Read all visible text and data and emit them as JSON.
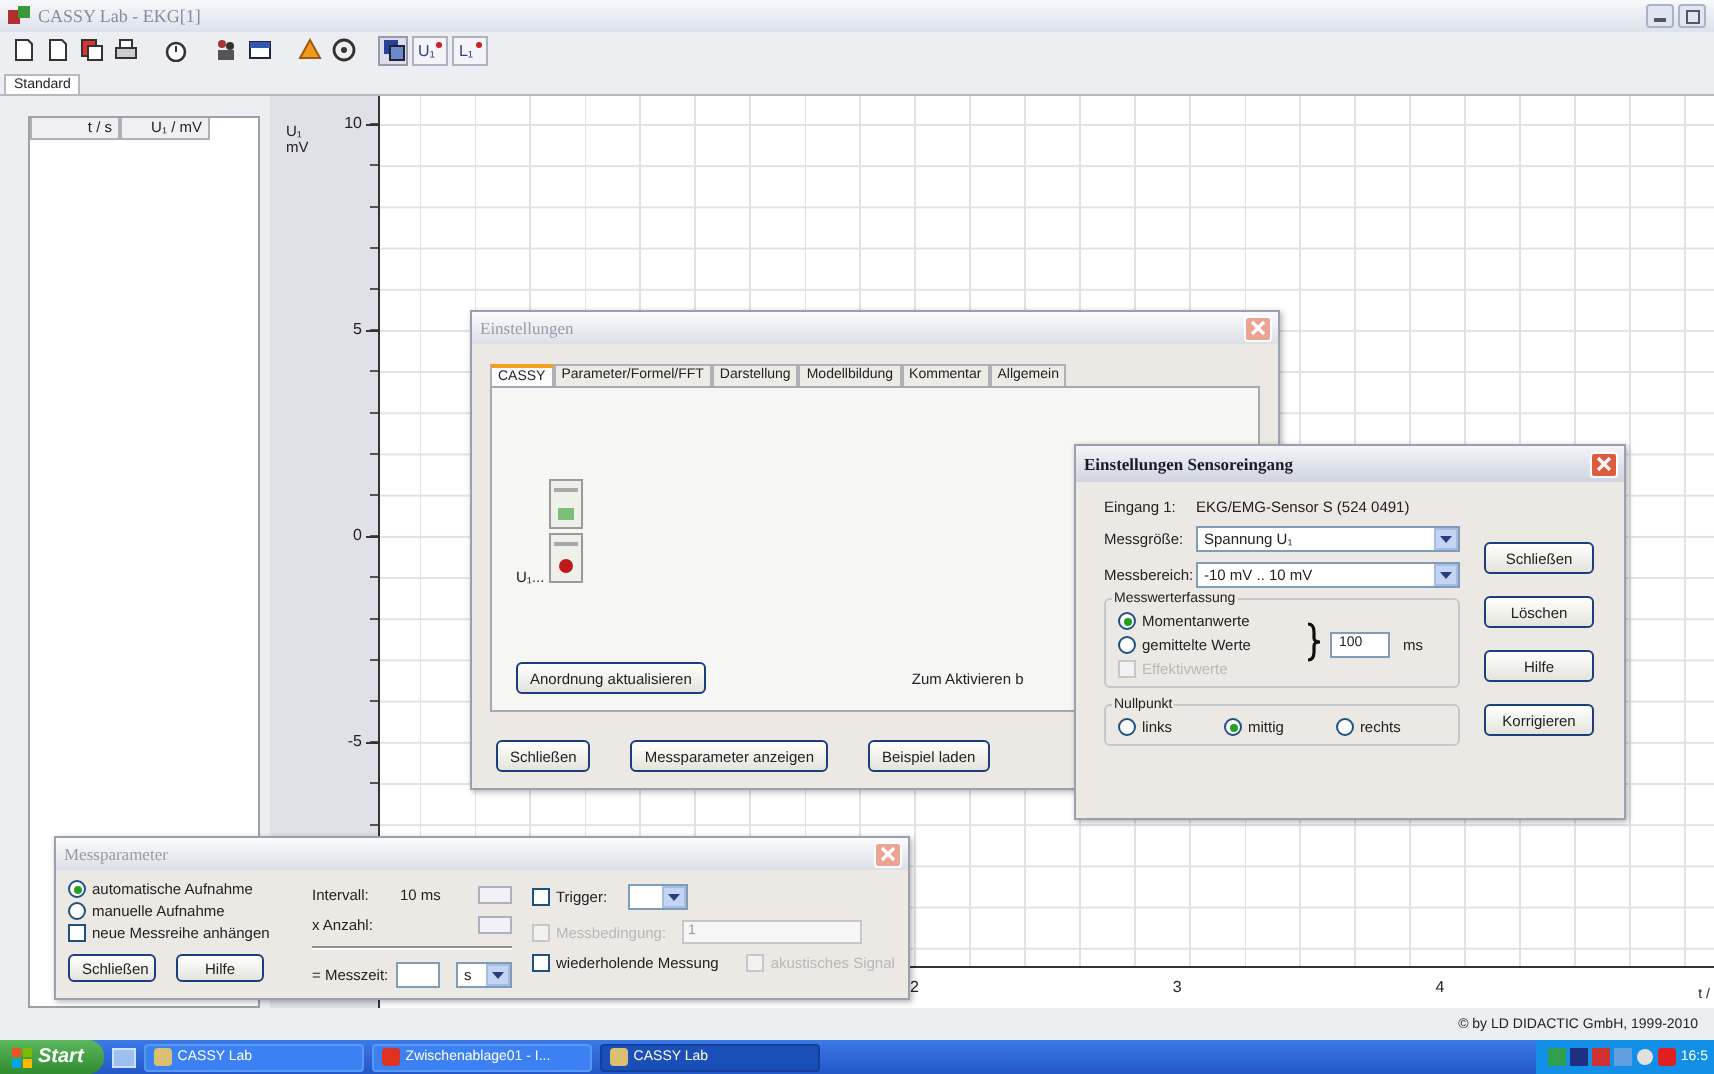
{
  "window": {
    "title": "CASSY Lab - EKG[1]"
  },
  "toolbar_labels": [
    {
      "label": "U₁"
    },
    {
      "label": "L₁"
    }
  ],
  "tabs": [
    {
      "label": "Standard",
      "selected": true
    }
  ],
  "table": {
    "columns": [
      "t / s",
      "U₁ / mV"
    ]
  },
  "graph": {
    "y_label": "U₁",
    "y_unit": "mV",
    "y_ticks": [
      "10",
      "5",
      "0",
      "-5"
    ],
    "x_ticks": [
      "2",
      "3",
      "4"
    ],
    "x_label": "t /"
  },
  "settings_dialog": {
    "title": "Einstellungen",
    "active": false,
    "tabs": [
      {
        "label": "CASSY",
        "selected": true
      },
      {
        "label": "Parameter/Formel/FFT",
        "selected": false
      },
      {
        "label": "Darstellung",
        "selected": false
      },
      {
        "label": "Modellbildung",
        "selected": false
      },
      {
        "label": "Kommentar",
        "selected": false
      },
      {
        "label": "Allgemein",
        "selected": false
      }
    ],
    "module_label": "U₁...",
    "update_button": "Anordnung aktualisieren",
    "hint": "Zum Aktivieren b",
    "buttons": [
      "Schließen",
      "Messparameter anzeigen",
      "Beispiel laden"
    ]
  },
  "sensor_dialog": {
    "title": "Einstellungen Sensoreingang",
    "active": true,
    "input_label": "Eingang 1:",
    "input_value": "EKG/EMG-Sensor S (524 0491)",
    "fields": [
      {
        "label": "Messgröße:",
        "value": "Spannung U₁"
      },
      {
        "label": "Messbereich:",
        "value": "-10 mV .. 10 mV"
      }
    ],
    "acquisition": {
      "title": "Messwerterfassung",
      "options": [
        {
          "label": "Momentanwerte",
          "selected": true
        },
        {
          "label": "gemittelte Werte",
          "selected": false
        }
      ],
      "rms": {
        "label": "Effektivwerte",
        "checked": false,
        "disabled": true
      },
      "average_time": "100",
      "unit": "ms"
    },
    "zero_point": {
      "title": "Nullpunkt",
      "options": [
        {
          "label": "links",
          "selected": false
        },
        {
          "label": "mittig",
          "selected": true
        },
        {
          "label": "rechts",
          "selected": false
        }
      ]
    },
    "buttons": [
      "Schließen",
      "Löschen",
      "Hilfe",
      "Korrigieren"
    ]
  },
  "measure_dialog": {
    "title": "Messparameter",
    "active": false,
    "modes": [
      {
        "label": "automatische Aufnahme",
        "selected": true
      },
      {
        "label": "manuelle Aufnahme",
        "selected": false
      }
    ],
    "append": {
      "label": "neue Messreihe anhängen",
      "checked": false,
      "disabled": false
    },
    "buttons": [
      "Schließen",
      "Hilfe"
    ],
    "interval_label": "Intervall:",
    "interval_value": "10 ms",
    "count_label": "x Anzahl:",
    "time_label": "= Messzeit:",
    "time_unit": "s",
    "trigger": {
      "label": "Trigger:",
      "checked": false,
      "disabled": false
    },
    "condition": {
      "label": "Messbedingung:",
      "value": "1",
      "checked": false,
      "disabled": true
    },
    "repeat": {
      "label": "wiederholende Messung",
      "checked": false,
      "disabled": false
    },
    "sound": {
      "label": "akustisches Signal",
      "checked": false,
      "disabled": true
    }
  },
  "footer": "© by LD DIDACTIC GmbH, 1999-2010",
  "taskbar": {
    "start": "Start",
    "items": [
      {
        "label": "CASSY Lab",
        "selected": false
      },
      {
        "label": "Zwischenablage01 - I...",
        "selected": false
      },
      {
        "label": "CASSY Lab",
        "selected": true
      }
    ],
    "clock": "16:5"
  }
}
